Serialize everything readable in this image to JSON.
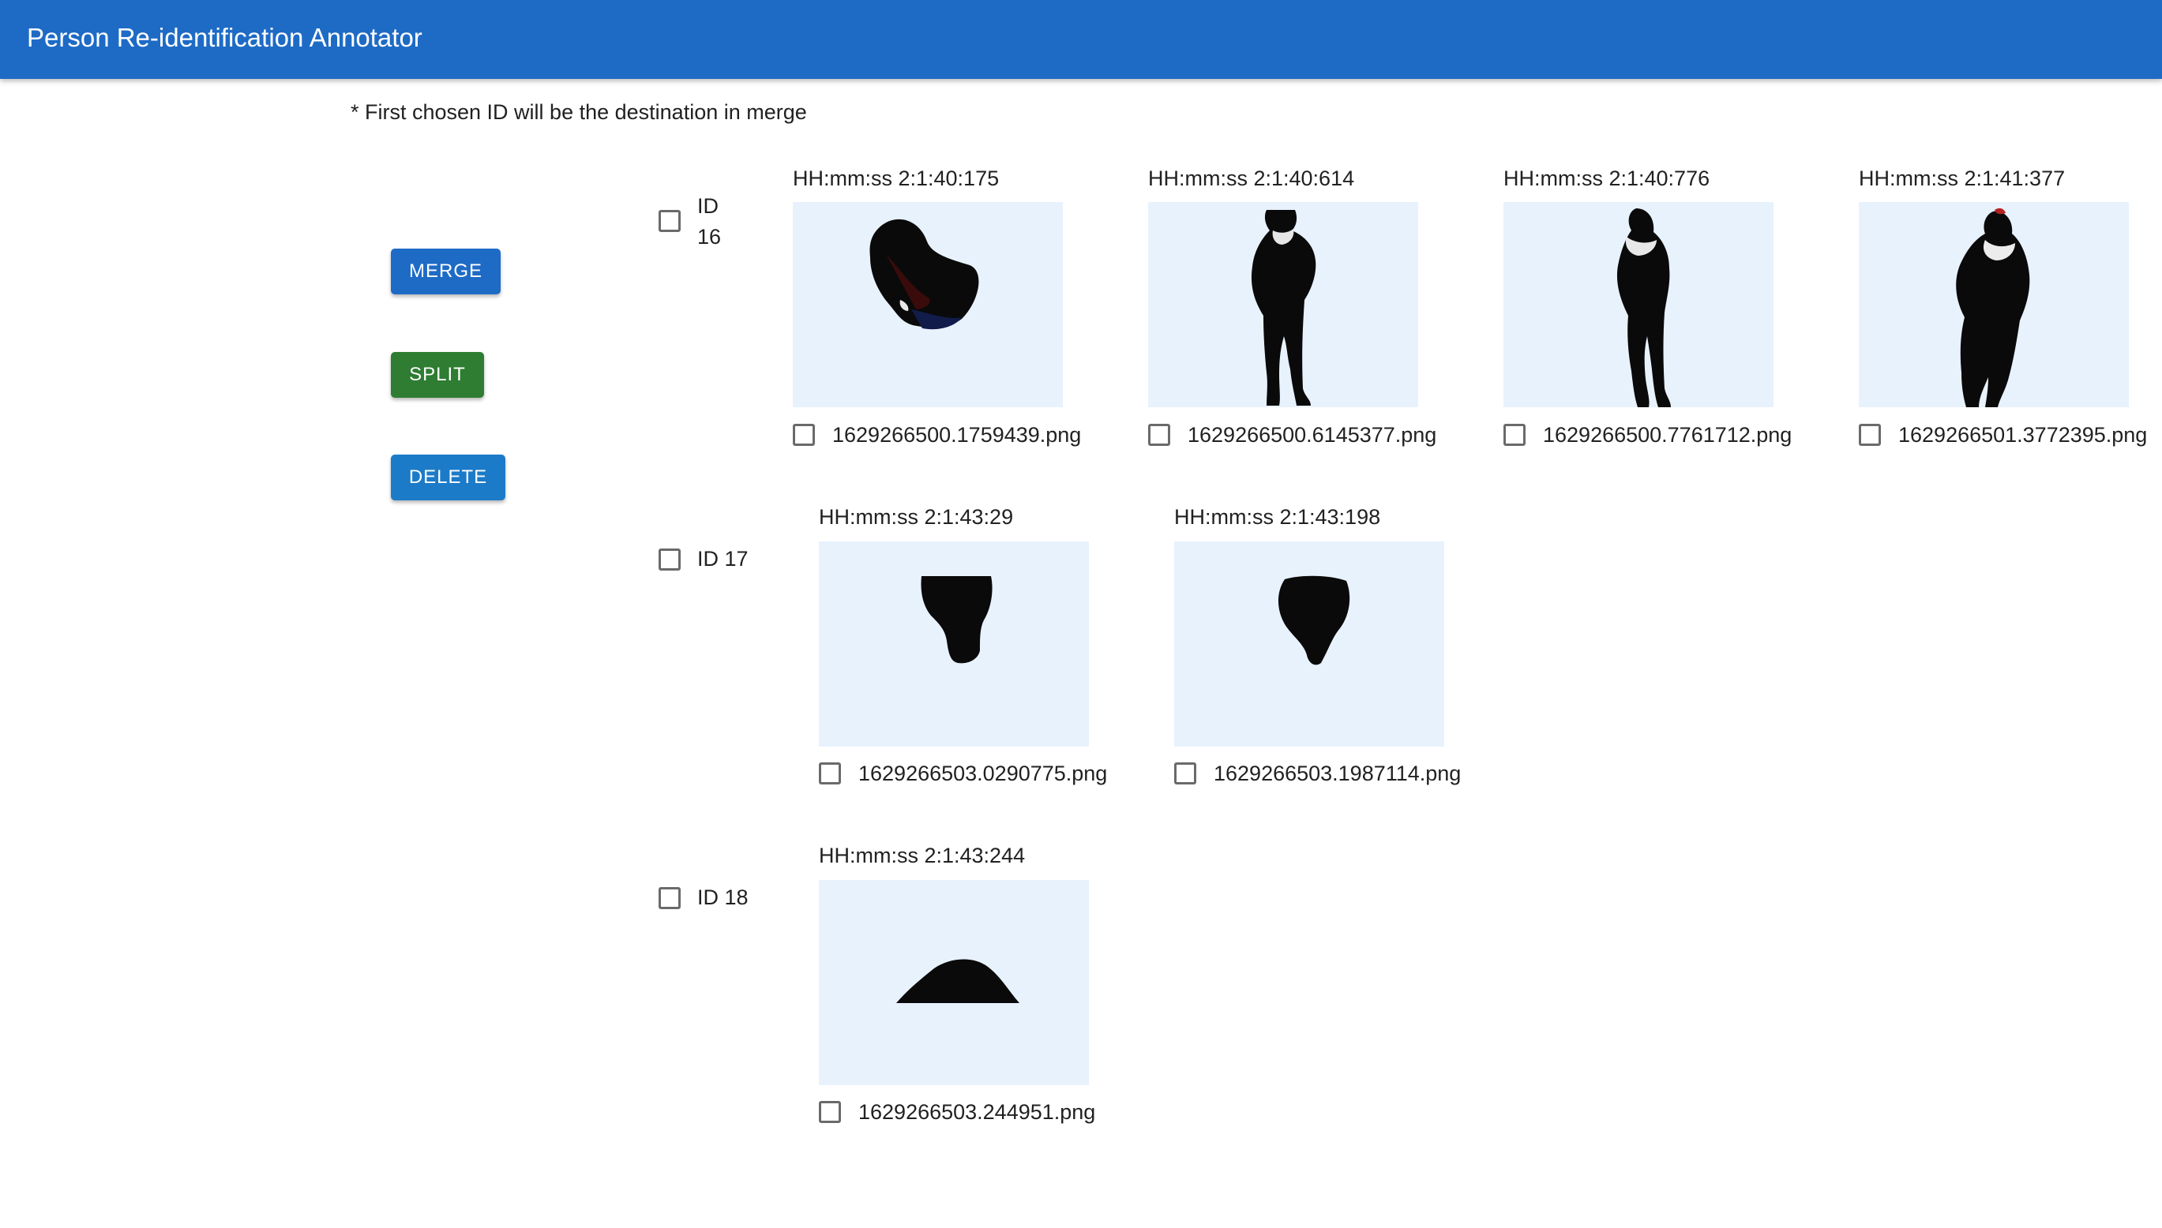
{
  "header": {
    "title": "Person Re-identification Annotator",
    "color": "#1e6bc6"
  },
  "note": "* First chosen ID will be the destination in merge",
  "actions": {
    "merge_label": "MERGE",
    "merge_color": "#1e6bc6",
    "split_label": "SPLIT",
    "split_color": "#2e7d32",
    "delete_label": "DELETE",
    "delete_color": "#1b7bc9"
  },
  "groups": [
    {
      "id_label": "ID 16",
      "id_word": "ID",
      "id_number": "16",
      "checked": false,
      "images": [
        {
          "timestamp": "HH:mm:ss 2:1:40:175",
          "filename": "1629266500.1759439.png",
          "checked": false,
          "silhouette": "crouched-figure"
        },
        {
          "timestamp": "HH:mm:ss 2:1:40:614",
          "filename": "1629266500.6145377.png",
          "checked": false,
          "silhouette": "standing-person"
        },
        {
          "timestamp": "HH:mm:ss 2:1:40:776",
          "filename": "1629266500.7761712.png",
          "checked": false,
          "silhouette": "standing-person"
        },
        {
          "timestamp": "HH:mm:ss 2:1:41:377",
          "filename": "1629266501.3772395.png",
          "checked": false,
          "silhouette": "standing-person"
        }
      ]
    },
    {
      "id_label": "ID 17",
      "checked": false,
      "images": [
        {
          "timestamp": "HH:mm:ss 2:1:43:29",
          "filename": "1629266503.0290775.png",
          "checked": false,
          "silhouette": "torso-fragment"
        },
        {
          "timestamp": "HH:mm:ss 2:1:43:198",
          "filename": "1629266503.1987114.png",
          "checked": false,
          "silhouette": "torso-fragment"
        }
      ]
    },
    {
      "id_label": "ID 18",
      "checked": false,
      "images": [
        {
          "timestamp": "HH:mm:ss 2:1:43:244",
          "filename": "1629266503.244951.png",
          "checked": false,
          "silhouette": "dome-fragment"
        }
      ]
    }
  ],
  "thumbnail_background": "#e8f2fd"
}
